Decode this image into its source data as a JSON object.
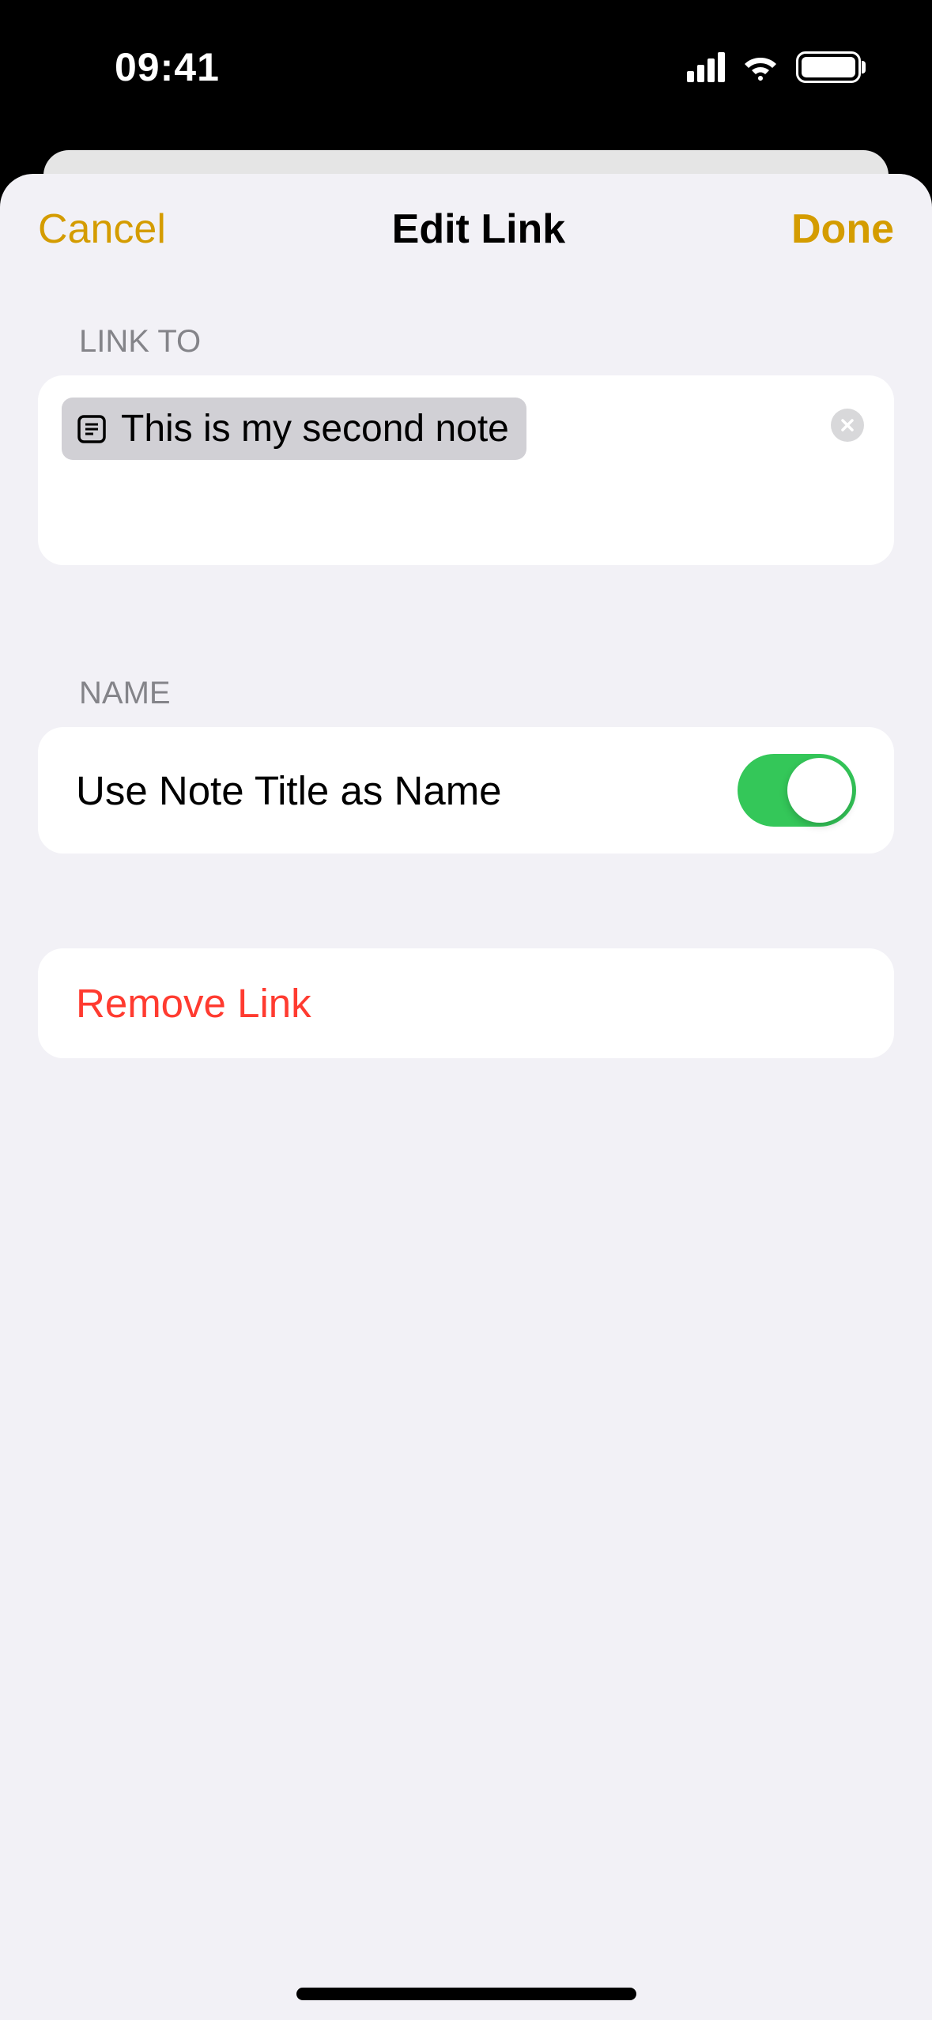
{
  "status": {
    "time": "09:41"
  },
  "modal": {
    "cancel": "Cancel",
    "title": "Edit Link",
    "done": "Done"
  },
  "linkTo": {
    "header": "LINK TO",
    "noteTitle": "This is my second note"
  },
  "name": {
    "header": "NAME",
    "toggleLabel": "Use Note Title as Name",
    "toggleState": true
  },
  "remove": {
    "label": "Remove Link"
  }
}
